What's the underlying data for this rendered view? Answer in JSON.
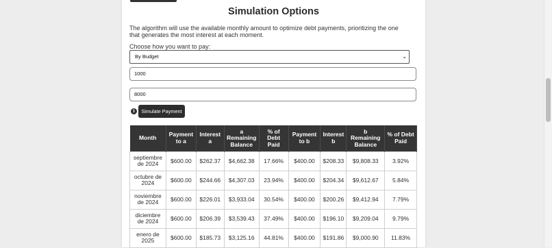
{
  "page": {
    "title": "Simulation Options",
    "description": "The algorithm will use the available monthly amount to optimize debt payments, prioritizing the one that generates the most interest at each moment.",
    "choose_label": "Choose how you want to pay:",
    "select_value": "By Budget",
    "input_1_value": "1000",
    "input_2_value": "8000",
    "info_icon_glyph": "i",
    "simulate_button": "Simulate Payment"
  },
  "table": {
    "headers": [
      "Month",
      "Payment to a",
      "Interest a",
      "a Remaining Balance",
      "% of Debt Paid",
      "Payment to b",
      "Interest b",
      "b Remaining Balance",
      "% of Debt Paid"
    ],
    "rows": [
      [
        "septiembre de 2024",
        "$600.00",
        "$262.37",
        "$4,662.38",
        "17.66%",
        "$400.00",
        "$208.33",
        "$9,808.33",
        "3.92%"
      ],
      [
        "octubre de 2024",
        "$600.00",
        "$244.66",
        "$4,307.03",
        "23.94%",
        "$400.00",
        "$204.34",
        "$9,612.67",
        "5.84%"
      ],
      [
        "noviembre de 2024",
        "$600.00",
        "$226.01",
        "$3,933.04",
        "30.54%",
        "$400.00",
        "$200.26",
        "$9,412.94",
        "7.79%"
      ],
      [
        "diciembre de 2024",
        "$600.00",
        "$206.39",
        "$3,539.43",
        "37.49%",
        "$400.00",
        "$196.10",
        "$9,209.04",
        "9.79%"
      ],
      [
        "enero de 2025",
        "$600.00",
        "$185.73",
        "$3,125.16",
        "44.81%",
        "$400.00",
        "$191.86",
        "$9,000.90",
        "11.83%"
      ]
    ]
  },
  "colors": {
    "header_bg": "#353535",
    "button_bg": "#2d2d2d",
    "page_bg": "#ededed"
  }
}
